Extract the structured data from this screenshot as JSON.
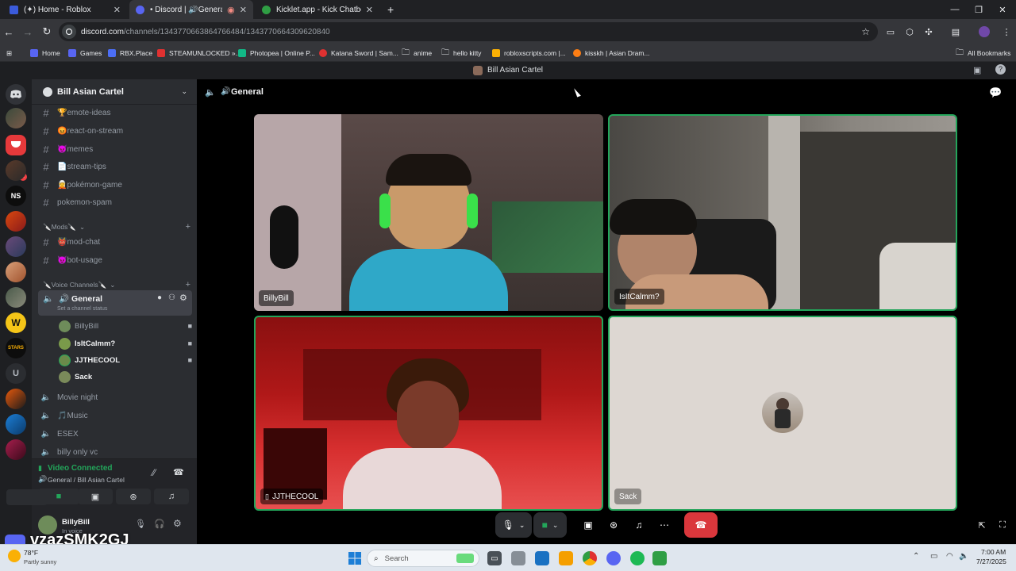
{
  "browser": {
    "tabs": [
      {
        "label": "(✦) Home - Roblox",
        "color": "#3b5bdb"
      },
      {
        "label": "• Discord | 🔊General | Bill",
        "color": "#5865f2"
      },
      {
        "label": "Kicklet.app - Kick Chatbot and C",
        "color": "#53fc18"
      }
    ],
    "new_tab": "+",
    "url_domain": "discord.com",
    "url_path": "/channels/1343770663864766484/1343770664309620840",
    "bookmarks": [
      {
        "label": "Home",
        "color": "#5865f2"
      },
      {
        "label": "Games",
        "color": "#5865f2"
      },
      {
        "label": "RBX.Place",
        "color": "#4c6ef5"
      },
      {
        "label": "STEAMUNLOCKED »...",
        "color": "#e03131"
      },
      {
        "label": "Photopea | Online P...",
        "color": "#12b886"
      },
      {
        "label": "Katana Sword | Sam...",
        "color": "#e03131"
      },
      {
        "label": "anime",
        "color": "folder"
      },
      {
        "label": "hello kitty",
        "color": "folder"
      },
      {
        "label": "robloxscripts.com |...",
        "color": "#fab005"
      },
      {
        "label": "kisskh | Asian Dram...",
        "color": "#fd7e14"
      }
    ],
    "all_bookmarks": "All Bookmarks"
  },
  "discord": {
    "window_title": "Bill Asian Cartel",
    "server_name": "Bill Asian Cartel",
    "channels": [
      {
        "emoji": "🏆",
        "name": "emote-ideas"
      },
      {
        "emoji": "😡",
        "name": "react-on-stream"
      },
      {
        "emoji": "😈",
        "name": "memes"
      },
      {
        "emoji": "📄",
        "name": "stream-tips"
      },
      {
        "emoji": "🧝",
        "name": "pokémon-game"
      },
      {
        "emoji": "",
        "name": "pokemon-spam"
      }
    ],
    "mods_category": "Mods",
    "mods_channels": [
      {
        "emoji": "👹",
        "name": "mod-chat"
      },
      {
        "emoji": "😈",
        "name": "bot-usage"
      }
    ],
    "voice_category": "Voice Channels",
    "active_voice": {
      "name": "General",
      "status_hint": "Set a channel status"
    },
    "voice_users": [
      {
        "name": "BillyBill",
        "color": "#6e8c5a",
        "muted": true
      },
      {
        "name": "IsItCalmm?",
        "color": "#7a9a4a",
        "muted": false
      },
      {
        "name": "JJTHECOOL",
        "color": "#6a8a4a",
        "muted": false
      },
      {
        "name": "Sack",
        "color": "#7a8a5a",
        "muted": false
      }
    ],
    "other_voice": [
      {
        "emoji": "",
        "name": "Movie night"
      },
      {
        "emoji": "🎵",
        "name": "Music"
      },
      {
        "emoji": "",
        "name": "ESEX"
      },
      {
        "emoji": "",
        "name": "billy only vc"
      }
    ],
    "connection": {
      "status": "Video Connected",
      "location": "General / Bill Asian Cartel",
      "color": "#23a55a"
    },
    "user": {
      "name": "BillyBill",
      "status": "In voice"
    },
    "call_header": "General",
    "participants": [
      {
        "name": "BillyBill",
        "mobile": false
      },
      {
        "name": "IsItCalmm?",
        "mobile": false
      },
      {
        "name": "JJTHECOOL",
        "mobile": true
      },
      {
        "name": "Sack",
        "mobile": false
      }
    ]
  },
  "overlay": {
    "watermark": "vzazSMK2GJ",
    "weather_temp": "78°F",
    "weather_desc": "Partly sunny"
  },
  "taskbar": {
    "search_placeholder": "Search",
    "time": "7:00 AM",
    "date": "7/27/2025"
  }
}
